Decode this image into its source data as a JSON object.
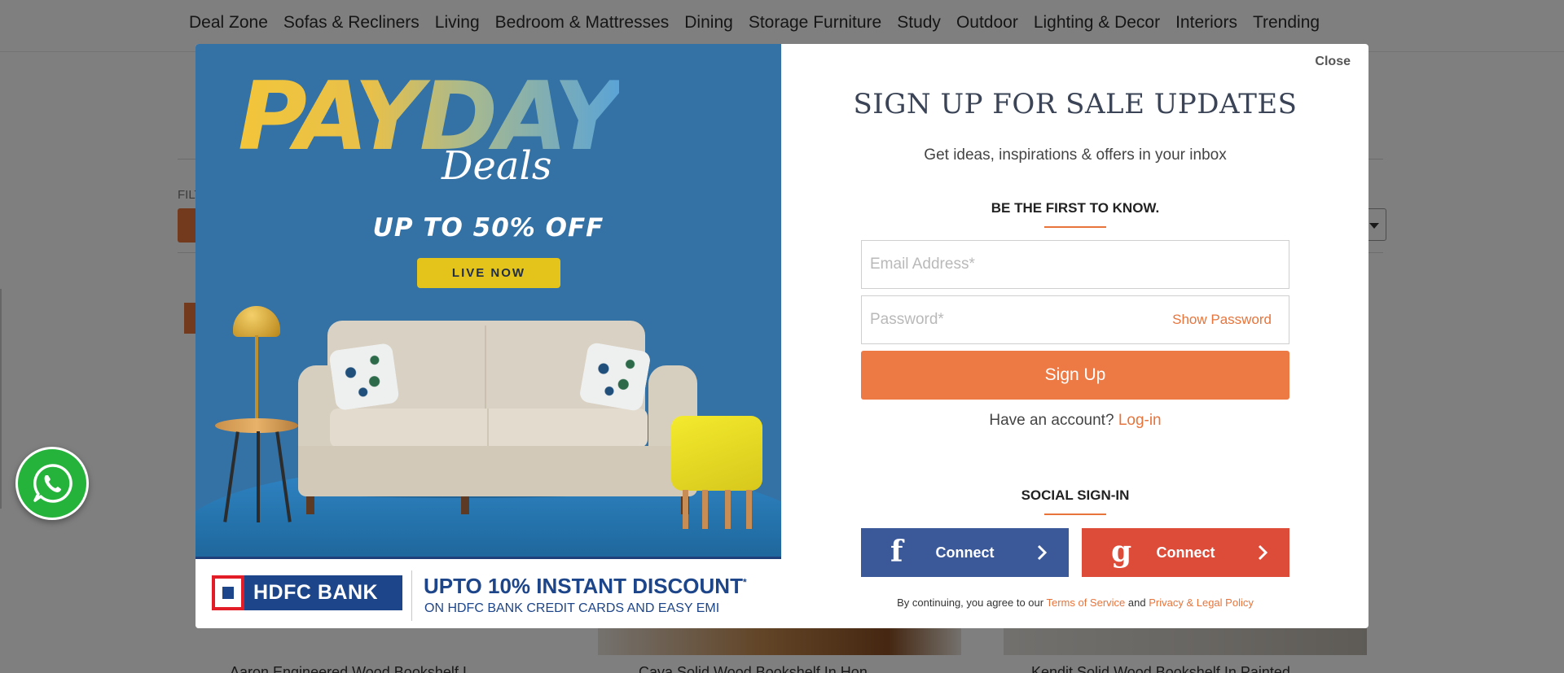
{
  "nav": {
    "items": [
      "Deal Zone",
      "Sofas & Recliners",
      "Living",
      "Bedroom & Mattresses",
      "Dining",
      "Storage Furniture",
      "Study",
      "Outdoor",
      "Lighting & Decor",
      "Interiors",
      "Trending"
    ]
  },
  "background": {
    "filter_label": "FILT",
    "card_titles": [
      "Aaron Engineered Wood Bookshelf I...",
      "Cava Solid Wood Bookshelf In Hon...",
      "Kendit Solid Wood Bookshelf In Painted..."
    ]
  },
  "promo": {
    "headline": "PAYDAY",
    "headline_script": "Deals",
    "offer": "UP TO 50% OFF",
    "badge": "LIVE NOW",
    "bank_name": "HDFC BANK",
    "bank_offer": "UPTO 10% INSTANT DISCOUNT",
    "bank_offer_mark": "*",
    "bank_offer_sub": "ON HDFC BANK CREDIT CARDS AND EASY EMI"
  },
  "modal": {
    "close_label": "Close",
    "title": "SIGN UP FOR SALE UPDATES",
    "subtitle": "Get ideas, inspirations & offers in your inbox",
    "section_heading": "BE THE FIRST TO KNOW.",
    "email_placeholder": "Email Address*",
    "email_value": "",
    "password_placeholder": "Password*",
    "password_value": "",
    "show_password_label": "Show Password",
    "signup_button": "Sign Up",
    "have_account_text": "Have an account?",
    "login_link": "Log-in",
    "social_heading": "SOCIAL SIGN-IN",
    "facebook_button": "Connect",
    "google_button": "Connect",
    "terms_prefix": "By continuing, you agree to our",
    "terms_link": "Terms of Service",
    "terms_and": "and",
    "privacy_link": "Privacy & Legal Policy"
  },
  "icons": {
    "whatsapp": "whatsapp-icon",
    "facebook": "facebook-icon",
    "google": "google-icon",
    "chevron": "chevron-right-icon"
  },
  "colors": {
    "accent": "#ed7a45",
    "facebook": "#3b5998",
    "google": "#dd4b39",
    "promo_bg": "#3471a4",
    "hdfc_blue": "#1d4589",
    "whatsapp": "#25b33c"
  }
}
